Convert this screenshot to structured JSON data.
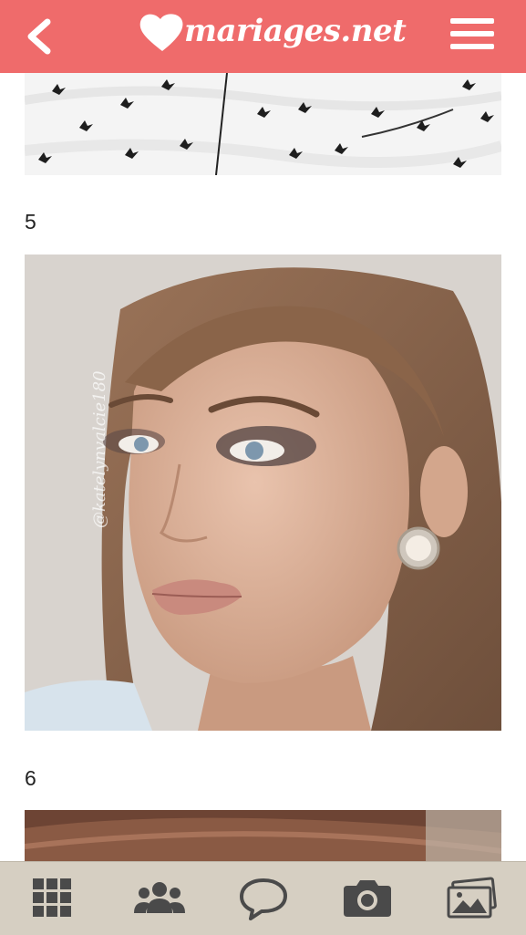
{
  "header": {
    "brand": "mariages.net",
    "back_icon": "chevron-left-icon",
    "menu_icon": "hamburger-menu-icon",
    "bg_color": "#ef6b6b"
  },
  "gallery": {
    "items": [
      {
        "number": "5"
      },
      {
        "number": "6"
      }
    ],
    "watermark": "@katelynvalcie180"
  },
  "tabbar": {
    "bg_color": "#d6cfc2",
    "icon_color": "#4a4a4a",
    "tabs": [
      {
        "icon": "grid-icon"
      },
      {
        "icon": "community-icon"
      },
      {
        "icon": "chat-bubble-icon"
      },
      {
        "icon": "camera-icon"
      },
      {
        "icon": "photos-icon"
      }
    ]
  }
}
